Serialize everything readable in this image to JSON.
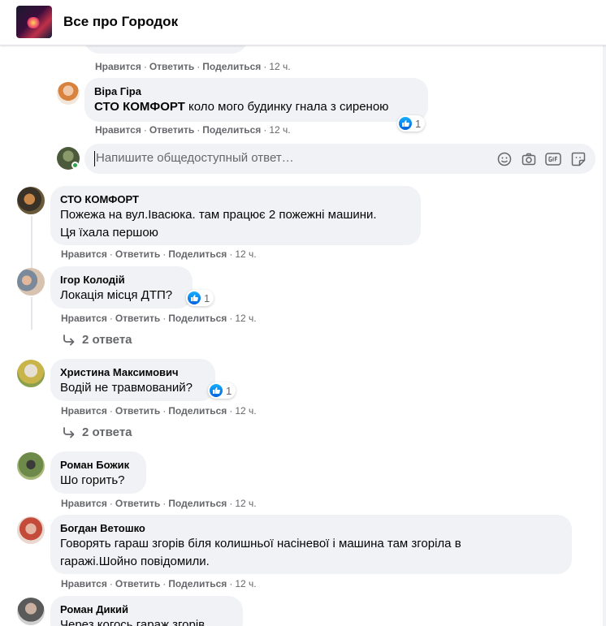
{
  "header": {
    "title": "Все про Городок"
  },
  "actions": {
    "like": "Нравится",
    "reply": "Ответить",
    "share": "Поделиться",
    "dot": "·"
  },
  "reply_box": {
    "placeholder": "Напишите общедоступный ответ…"
  },
  "top_partial": {
    "time": "12 ч."
  },
  "comments": [
    {
      "author": "Віра Гіра",
      "bold": "СТО КОМФОРТ",
      "text": " коло мого будинку гнала з сиреною",
      "likes": "1",
      "time": "12 ч."
    },
    {
      "author": "СТО КОМФОРТ",
      "line1": "Пожежа на вул.Івасюка. там працює 2 пожежні машини.",
      "line2": "Ця їхала першою",
      "time": "12 ч."
    },
    {
      "author": "Ігор Колодій",
      "text": "Локація місця ДТП?",
      "likes": "1",
      "time": "12 ч.",
      "replies": "2 ответа"
    },
    {
      "author": "Христина Максимович",
      "text": "Водій не травмований?",
      "likes": "1",
      "time": "12 ч.",
      "replies": "2 ответа"
    },
    {
      "author": "Роман Божик",
      "text": "Шо горить?",
      "time": "12 ч."
    },
    {
      "author": "Богдан Ветошко",
      "line1": "Говорять гараш згорів біля колишньої насіневої і машина там згоріла в",
      "line2": "гаражі.Шойно повідомили.",
      "time": "12 ч."
    },
    {
      "author": "Роман Дикий",
      "text": "Через когось гараж згорів"
    }
  ],
  "colors": {
    "like_blue": "#1877f2",
    "bubble": "#f0f2f5",
    "meta": "#65676b"
  }
}
